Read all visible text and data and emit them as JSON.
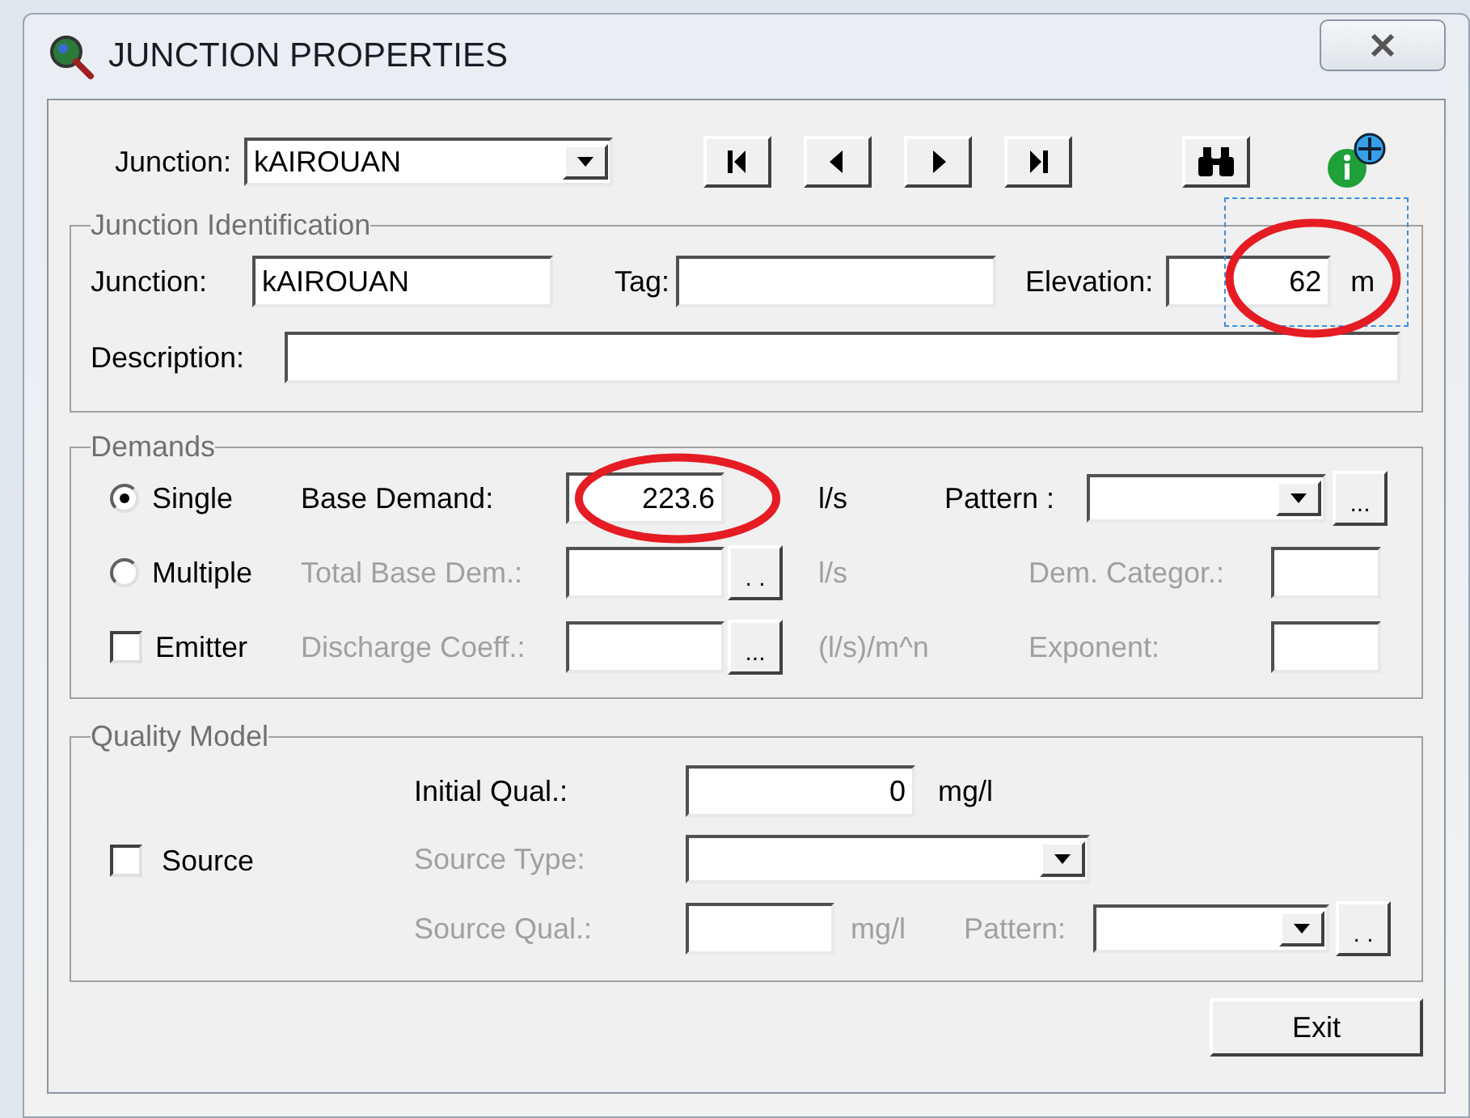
{
  "window": {
    "title": "JUNCTION PROPERTIES"
  },
  "navigator": {
    "label": "Junction:",
    "value": "kAIROUAN"
  },
  "identification": {
    "title": "Junction Identification",
    "junction": {
      "label": "Junction:",
      "value": "kAIROUAN"
    },
    "tag": {
      "label": "Tag:"
    },
    "elevation": {
      "label": "Elevation:",
      "value": "62",
      "unit": "m",
      "highlighted": true,
      "selected": true
    },
    "description": {
      "label": "Description:"
    }
  },
  "demands": {
    "title": "Demands",
    "rows": [
      {
        "kind": "radio",
        "label": "Single",
        "selected": true,
        "field": {
          "label": "Base Demand:",
          "value": "223.6",
          "unit": "l/s",
          "disabled": false,
          "highlighted": true
        },
        "extra": {
          "kind": "pattern",
          "label": "Pattern :",
          "browse": "...",
          "disabled": false
        }
      },
      {
        "kind": "radio",
        "label": "Multiple",
        "selected": false,
        "field": {
          "label": "Total Base Dem.:",
          "unit": "l/s",
          "disabled": true,
          "highlighted": false,
          "browse": ". ."
        },
        "extra": {
          "kind": "input",
          "label": "Dem. Categor.:",
          "disabled": true
        }
      },
      {
        "kind": "checkbox",
        "label": "Emitter",
        "checked": false,
        "field": {
          "label": "Discharge Coeff.:",
          "unit": "(l/s)/m^n",
          "disabled": true,
          "highlighted": false,
          "browse": "..."
        },
        "extra": {
          "kind": "input",
          "label": "Exponent:",
          "disabled": true
        }
      }
    ]
  },
  "quality": {
    "title": "Quality Model",
    "source": {
      "label": "Source",
      "checked": false
    },
    "initial": {
      "label": "Initial Qual.:",
      "value": "0",
      "unit": "mg/l",
      "disabled": false
    },
    "source_type": {
      "label": "Source Type:",
      "disabled": true
    },
    "source_qual": {
      "label": "Source Qual.:",
      "unit": "mg/l",
      "disabled": true
    },
    "pattern": {
      "label": "Pattern:",
      "browse": ". .",
      "disabled": true
    }
  },
  "exit_button": "Exit"
}
